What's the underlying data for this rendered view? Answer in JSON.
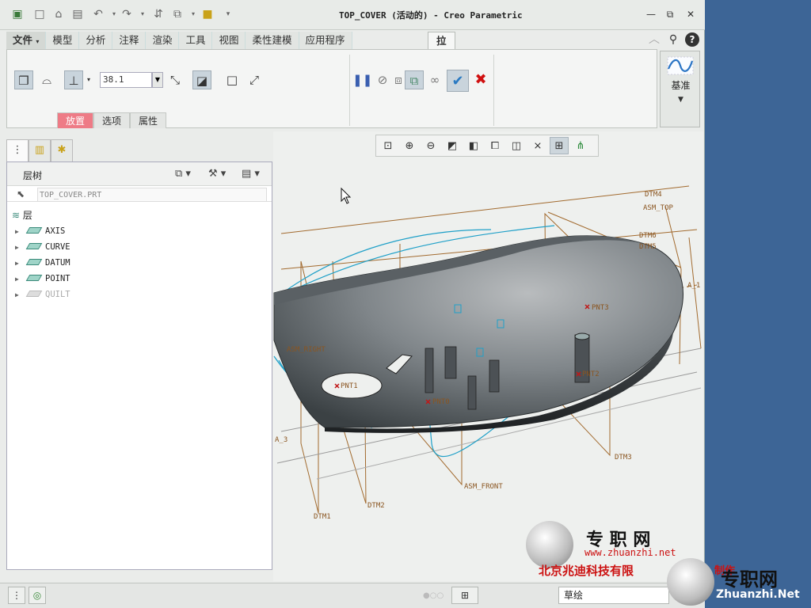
{
  "window": {
    "title": "TOP_COVER (活动的) - Creo Parametric",
    "minimize_icon": "minimize-icon",
    "restore_icon": "restore-icon",
    "close_icon": "close-icon"
  },
  "quick_access": [
    "window-icon",
    "new-icon",
    "open-icon",
    "save-icon",
    "undo-icon",
    "redo-icon",
    "regenerate-icon",
    "windows-icon",
    "close-window-icon",
    "customize-icon"
  ],
  "ribbon": {
    "tabs": [
      "文件",
      "模型",
      "分析",
      "注释",
      "渲染",
      "工具",
      "视图",
      "柔性建模",
      "应用程序"
    ],
    "active_tab": "拉伸",
    "depth_value": "38.1",
    "subtabs": [
      "放置",
      "选项",
      "属性"
    ],
    "active_subtab": "放置",
    "datum_group_label": "基准"
  },
  "panel": {
    "title": "层树",
    "model_name": "TOP_COVER.PRT",
    "root_label": "层",
    "items": [
      {
        "label": "AXIS",
        "dim": false
      },
      {
        "label": "CURVE",
        "dim": false
      },
      {
        "label": "DATUM",
        "dim": false
      },
      {
        "label": "POINT",
        "dim": false
      },
      {
        "label": "QUILT",
        "dim": true
      }
    ]
  },
  "view_toolbar": [
    "refit-icon",
    "zoom-in-icon",
    "zoom-out-icon",
    "repaint-icon",
    "display-style-icon",
    "saved-views-icon",
    "view-manager-icon",
    "datum-display-icon",
    "annotation-display-icon",
    "spin-center-icon"
  ],
  "model_labels": {
    "dtm4": "DTM4",
    "asm_top": "ASM_TOP",
    "dtm6": "DTM6",
    "dtm5": "DTM5",
    "axis_a": "A_1",
    "pnt3": "PNT3",
    "pnt2": "PNT2",
    "pnt1": "PNT1",
    "pnt0": "PNT0",
    "asm_right": "ASM_RIGHT",
    "a3": "A_3",
    "dtm3": "DTM3",
    "asm_front": "ASM_FRONT",
    "dtm2": "DTM2",
    "dtm1": "DTM1"
  },
  "status": {
    "filter_value": "草绘"
  },
  "watermark": {
    "brand_cn": "专  职  网",
    "url": "www.zhuanzhi.net",
    "company": "北京兆迪科技有限",
    "corner_cn": "专职网",
    "corner_en": "Zhuanzhi.Net",
    "corner_stamp": "制作"
  },
  "colors": {
    "accent_active_subtab": "#ee7b86",
    "datum_plane": "#a26a2e",
    "curve": "#1fa0c8",
    "desktop": "#3d6596"
  }
}
